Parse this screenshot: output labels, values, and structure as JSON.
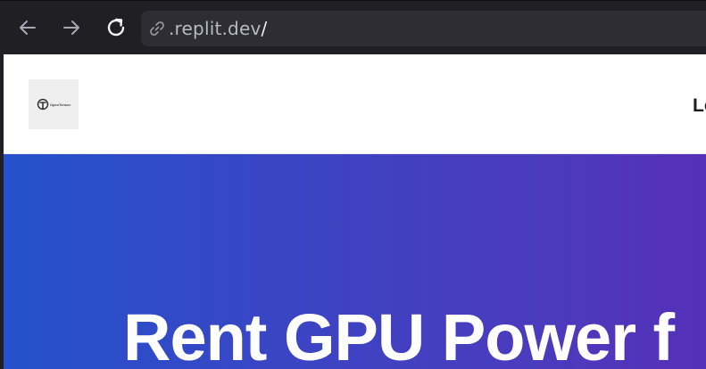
{
  "browser": {
    "url_host": ".replit.dev",
    "url_path": "/"
  },
  "site": {
    "logo_text": "OpenTensor",
    "nav_link": "Lo",
    "hero_title": "Rent GPU Power f"
  },
  "colors": {
    "hero_gradient_start": "#2452cc",
    "hero_gradient_end": "#5530b8",
    "browser_chrome": "#202024"
  },
  "icons": [
    "back-arrow-icon",
    "forward-arrow-icon",
    "reload-icon",
    "link-icon"
  ]
}
